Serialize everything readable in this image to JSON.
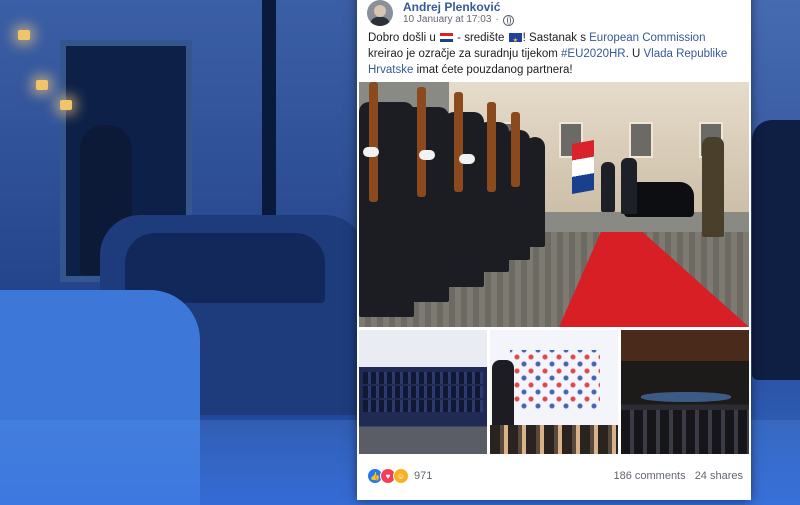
{
  "post": {
    "author": "Andrej Plenković",
    "date": "10 January at 17:03",
    "text": {
      "p1": "Dobro došli u",
      "p2": " - središte ",
      "p3": "! Sastanak s ",
      "link1": "European Commission",
      "p4": " kreirao je ozračje za suradnju tijekom ",
      "hashtag": "#EU2020HR",
      "p5": ". U ",
      "link2": "Vlada Republike Hrvatske",
      "p6": " imat ćete pouzdanog partnera!"
    },
    "reactions": {
      "icons": [
        "like-icon",
        "love-icon",
        "haha-icon"
      ],
      "count": "971"
    },
    "comments": "186 comments",
    "shares": "24 shares"
  },
  "colors": {
    "link": "#385898",
    "carpet": "#d81f26",
    "background_tint": "#1b3a78"
  }
}
